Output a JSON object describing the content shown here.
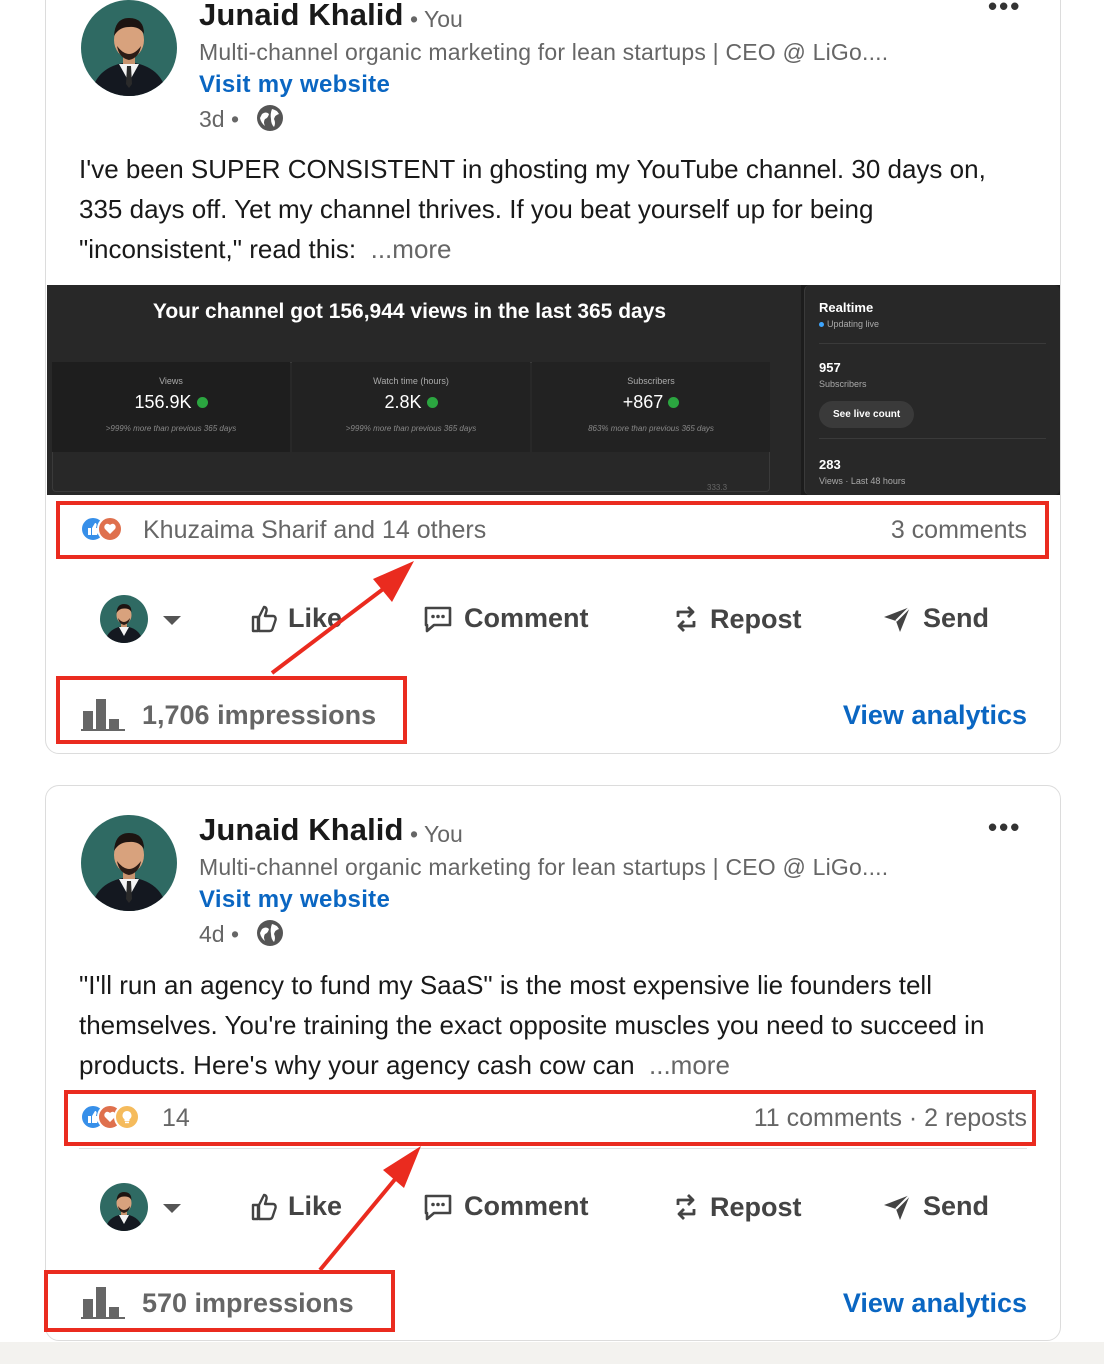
{
  "posts": [
    {
      "author": "Junaid Khalid",
      "you_label": "• You",
      "headline": "Multi-channel organic marketing for lean startups | CEO @ LiGo....",
      "website_link": "Visit my website",
      "time": "3d •",
      "text": "I've been SUPER CONSISTENT in ghosting my YouTube channel. 30 days on, 335 days off. Yet my channel thrives. If you beat yourself up for being \"inconsistent,\" read this:",
      "see_more": "...more",
      "image": {
        "headline": "Your channel got 156,944 views in the last 365 days",
        "stats": [
          {
            "label": "Views",
            "value": "156.9K",
            "note": ">999% more than previous 365 days"
          },
          {
            "label": "Watch time (hours)",
            "value": "2.8K",
            "note": ">999% more than previous 365 days"
          },
          {
            "label": "Subscribers",
            "value": "+867",
            "note": "863% more than previous 365 days"
          }
        ],
        "realtime": {
          "title": "Realtime",
          "status": "Updating live",
          "subscribers_value": "957",
          "subscribers_label": "Subscribers",
          "live_button": "See live count",
          "views_value": "283",
          "views_label": "Views · Last 48 hours"
        },
        "partial_value": "333.3"
      },
      "reactions_text": "Khuzaima Sharif and 14 others",
      "comments_text": "3 comments",
      "impressions": "1,706 impressions",
      "analytics_link": "View analytics"
    },
    {
      "author": "Junaid Khalid",
      "you_label": "• You",
      "headline": "Multi-channel organic marketing for lean startups | CEO @ LiGo....",
      "website_link": "Visit my website",
      "time": "4d •",
      "text": "\"I'll run an agency to fund my SaaS\" is the most expensive lie founders tell themselves. You're training the exact opposite muscles you need to succeed in products. Here's why your agency cash cow can",
      "see_more": "...more",
      "reactions_text": "14",
      "comments_text": "11 comments · 2 reposts",
      "impressions": "570 impressions",
      "analytics_link": "View analytics"
    }
  ],
  "actions": {
    "like": "Like",
    "comment": "Comment",
    "repost": "Repost",
    "send": "Send"
  },
  "colors": {
    "brand_blue": "#0a66c2",
    "annotation_red": "#ea2b1f",
    "youtube_green": "#2ba640"
  }
}
